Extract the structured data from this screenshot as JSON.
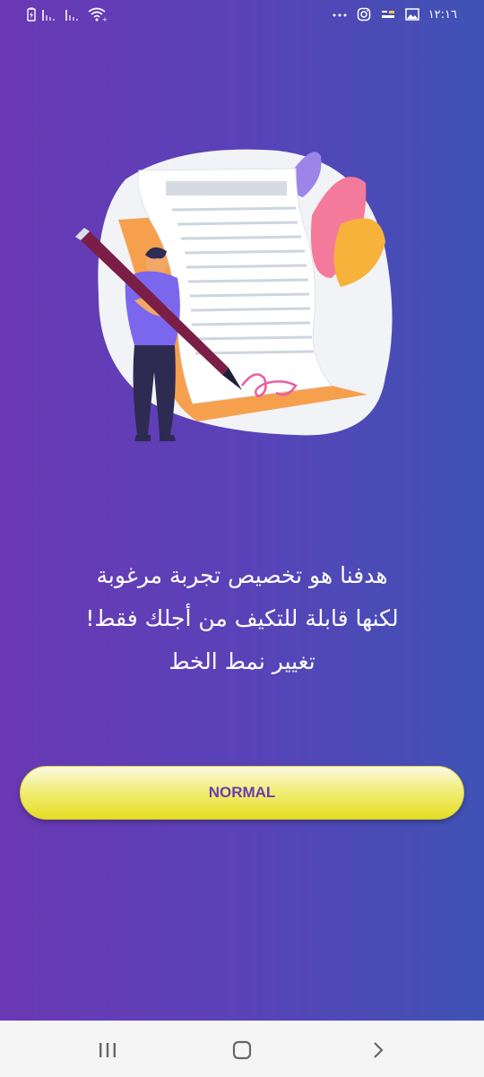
{
  "status_bar": {
    "time": "١٢:١٦",
    "left_icons": [
      "battery-saver-icon",
      "signal-icon",
      "signal-icon",
      "wifi-icon"
    ],
    "right_icons": [
      "more-dots-icon",
      "instagram-icon",
      "notification-icon",
      "gallery-icon"
    ]
  },
  "illustration": {
    "name": "writing-contract-illustration"
  },
  "message": {
    "line1": "هدفنا هو تخصيص تجربة مرغوبة",
    "line2": "لكنها قابلة للتكيف من أجلك فقط!",
    "line3": "تغيير نمط الخط"
  },
  "font_button": {
    "label": "NORMAL"
  },
  "nav_bar": {
    "icons": [
      "recent-apps-icon",
      "home-icon",
      "back-icon"
    ]
  },
  "colors": {
    "gradient_start": "#6a38b4",
    "gradient_end": "#3f53b5",
    "button_yellow": "#f2ee7c",
    "button_text": "#6a3cb0"
  }
}
